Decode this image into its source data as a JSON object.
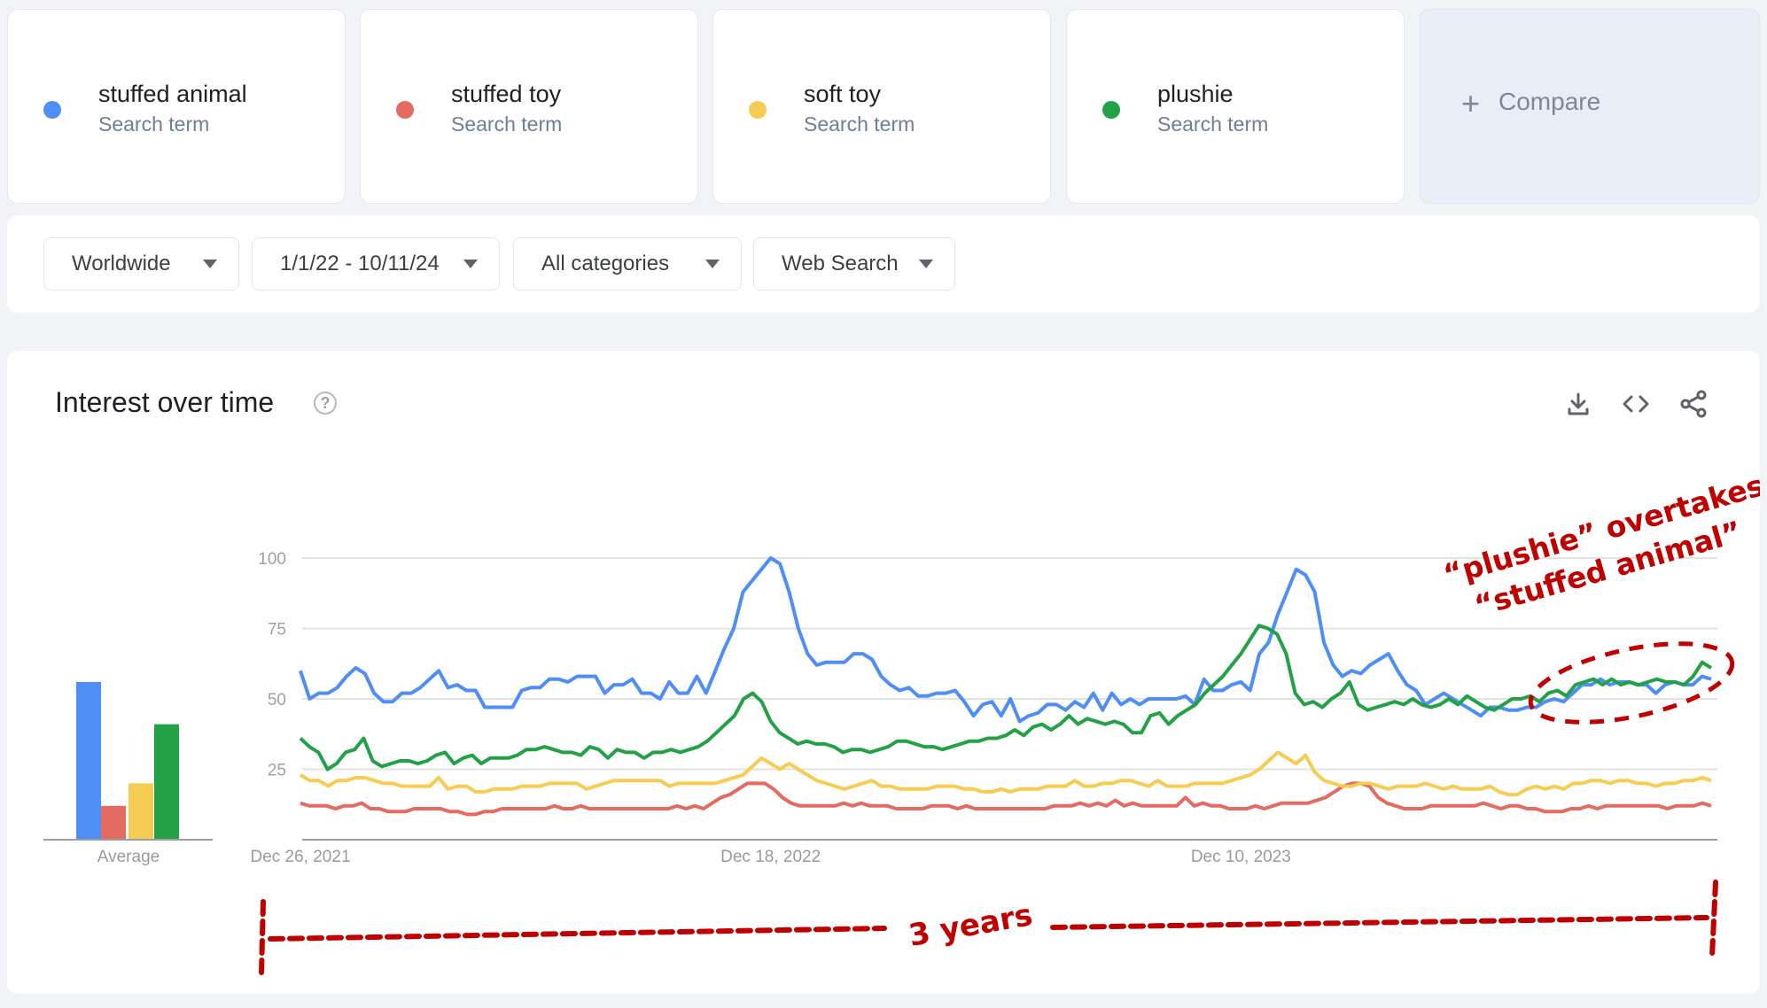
{
  "terms": [
    {
      "name": "stuffed animal",
      "sub": "Search term",
      "color": "#4e8ef5"
    },
    {
      "name": "stuffed toy",
      "sub": "Search term",
      "color": "#e56a61"
    },
    {
      "name": "soft toy",
      "sub": "Search term",
      "color": "#f6cd52"
    },
    {
      "name": "plushie",
      "sub": "Search term",
      "color": "#22a147"
    }
  ],
  "compare": {
    "icon": "plus-icon",
    "label": "Compare"
  },
  "filters": [
    {
      "label": "Worldwide"
    },
    {
      "label": "1/1/22 - 10/11/24"
    },
    {
      "label": "All categories"
    },
    {
      "label": "Web Search"
    }
  ],
  "panel": {
    "title": "Interest over time",
    "help_icon": "?",
    "tools": [
      "download-icon",
      "embed-code-icon",
      "share-icon"
    ]
  },
  "annotations": {
    "callout_line1": "“plushie” overtakes",
    "callout_line2": "“stuffed animal”",
    "span_label": "3 years",
    "color": "#c00000"
  },
  "chart_data": {
    "type": "line",
    "title": "Interest over time",
    "xlabel": "",
    "ylabel": "",
    "ylim": [
      0,
      100
    ],
    "yticks": [
      25,
      50,
      75,
      100
    ],
    "xtick_labels": [
      {
        "label": "Dec 26, 2021",
        "index": 0
      },
      {
        "label": "Dec 18, 2022",
        "index": 51
      },
      {
        "label": "Dec 10, 2023",
        "index": 102
      }
    ],
    "x_start": "Dec 26, 2021",
    "x_interval": "weekly",
    "grid": true,
    "legend": "top (term cards)",
    "averages": {
      "label": "Average",
      "values": [
        56,
        12,
        20,
        41
      ]
    },
    "series": [
      {
        "name": "stuffed animal",
        "color": "#4e8ef5",
        "values": [
          60,
          50,
          52,
          52,
          54,
          58,
          61,
          59,
          52,
          49,
          49,
          52,
          52,
          54,
          57,
          60,
          54,
          55,
          53,
          53,
          47,
          47,
          47,
          47,
          53,
          54,
          54,
          57,
          57,
          56,
          58,
          58,
          58,
          52,
          55,
          55,
          57,
          52,
          52,
          50,
          56,
          52,
          52,
          58,
          52,
          60,
          68,
          75,
          88,
          92,
          96,
          100,
          98,
          88,
          75,
          66,
          62,
          63,
          63,
          63,
          66,
          66,
          64,
          58,
          55,
          53,
          54,
          51,
          51,
          52,
          52,
          53,
          49,
          44,
          48,
          49,
          44,
          50,
          42,
          44,
          45,
          48,
          48,
          46,
          49,
          47,
          52,
          46,
          52,
          48,
          50,
          48,
          50,
          50,
          50,
          50,
          51,
          48,
          57,
          53,
          53,
          55,
          56,
          53,
          66,
          70,
          80,
          88,
          96,
          94,
          88,
          70,
          62,
          58,
          60,
          59,
          62,
          64,
          66,
          60,
          55,
          53,
          48,
          50,
          52,
          50,
          48,
          46,
          44,
          47,
          47,
          46,
          46,
          47,
          47,
          49,
          50,
          49,
          52,
          55,
          55,
          57,
          55,
          56,
          56,
          55,
          55,
          52,
          55,
          56,
          55,
          55,
          58,
          57
        ]
      },
      {
        "name": "stuffed toy",
        "color": "#e56a61",
        "values": [
          13,
          12,
          12,
          12,
          11,
          12,
          12,
          13,
          11,
          11,
          10,
          10,
          10,
          11,
          11,
          11,
          11,
          10,
          10,
          9,
          9,
          10,
          10,
          11,
          11,
          11,
          11,
          11,
          11,
          12,
          11,
          11,
          12,
          11,
          11,
          11,
          11,
          11,
          11,
          11,
          11,
          11,
          11,
          12,
          11,
          12,
          11,
          13,
          15,
          16,
          18,
          20,
          20,
          20,
          18,
          15,
          13,
          12,
          12,
          12,
          12,
          12,
          13,
          12,
          13,
          12,
          12,
          12,
          11,
          11,
          11,
          11,
          12,
          12,
          12,
          11,
          12,
          11,
          11,
          11,
          11,
          11,
          11,
          11,
          11,
          11,
          12,
          12,
          12,
          13,
          12,
          13,
          12,
          14,
          12,
          13,
          12,
          12,
          12,
          12,
          12,
          15,
          12,
          13,
          12,
          12,
          11,
          11,
          11,
          12,
          11,
          12,
          13,
          13,
          13,
          13,
          14,
          15,
          17,
          19,
          20,
          20,
          19,
          15,
          13,
          12,
          11,
          11,
          11,
          12,
          12,
          12,
          12,
          12,
          12,
          13,
          12,
          11,
          12,
          12,
          11,
          11,
          10,
          10,
          10,
          11,
          11,
          12,
          11,
          12,
          12,
          12,
          12,
          12,
          12,
          12,
          11,
          12,
          12,
          12,
          13,
          12
        ]
      },
      {
        "name": "soft toy",
        "color": "#f6cd52",
        "values": [
          23,
          21,
          21,
          19,
          21,
          21,
          22,
          22,
          21,
          20,
          20,
          19,
          19,
          19,
          19,
          22,
          18,
          19,
          19,
          17,
          17,
          18,
          18,
          18,
          19,
          19,
          19,
          20,
          20,
          20,
          20,
          18,
          19,
          20,
          21,
          21,
          21,
          21,
          21,
          21,
          19,
          20,
          20,
          20,
          20,
          20,
          21,
          22,
          23,
          26,
          29,
          27,
          25,
          27,
          25,
          23,
          21,
          20,
          19,
          18,
          19,
          20,
          21,
          19,
          19,
          18,
          18,
          18,
          18,
          19,
          19,
          19,
          18,
          18,
          17,
          17,
          18,
          17,
          18,
          18,
          18,
          19,
          19,
          19,
          21,
          19,
          19,
          20,
          20,
          21,
          21,
          20,
          19,
          21,
          19,
          19,
          19,
          20,
          20,
          20,
          20,
          21,
          22,
          23,
          25,
          28,
          31,
          29,
          27,
          30,
          24,
          21,
          20,
          19,
          19,
          20,
          20,
          19,
          18,
          19,
          19,
          19,
          20,
          19,
          18,
          19,
          18,
          18,
          18,
          19,
          17,
          16,
          16,
          18,
          19,
          18,
          19,
          18,
          20,
          20,
          21,
          21,
          20,
          21,
          21,
          20,
          20,
          19,
          20,
          20,
          21,
          21,
          22,
          21
        ]
      },
      {
        "name": "plushie",
        "color": "#22a147",
        "values": [
          36,
          33,
          31,
          25,
          27,
          31,
          32,
          36,
          28,
          26,
          27,
          28,
          28,
          27,
          28,
          30,
          31,
          27,
          29,
          30,
          27,
          29,
          29,
          29,
          30,
          32,
          32,
          33,
          32,
          31,
          31,
          30,
          33,
          32,
          29,
          32,
          31,
          31,
          29,
          31,
          31,
          32,
          31,
          32,
          33,
          35,
          38,
          41,
          44,
          50,
          52,
          49,
          42,
          38,
          36,
          34,
          35,
          34,
          34,
          33,
          31,
          32,
          32,
          31,
          32,
          33,
          35,
          35,
          34,
          33,
          33,
          32,
          33,
          34,
          35,
          35,
          36,
          36,
          37,
          39,
          37,
          40,
          41,
          39,
          41,
          44,
          41,
          43,
          42,
          41,
          42,
          41,
          38,
          38,
          44,
          45,
          41,
          44,
          46,
          48,
          52,
          55,
          58,
          62,
          66,
          71,
          76,
          75,
          73,
          66,
          52,
          48,
          49,
          47,
          50,
          52,
          56,
          48,
          46,
          47,
          48,
          49,
          48,
          50,
          48,
          47,
          48,
          50,
          48,
          51,
          49,
          47,
          46,
          48,
          50,
          50,
          51,
          49,
          52,
          53,
          51,
          55,
          56,
          57,
          55,
          57,
          55,
          56,
          55,
          56,
          57,
          56,
          56,
          55,
          58,
          63,
          61
        ]
      }
    ]
  }
}
